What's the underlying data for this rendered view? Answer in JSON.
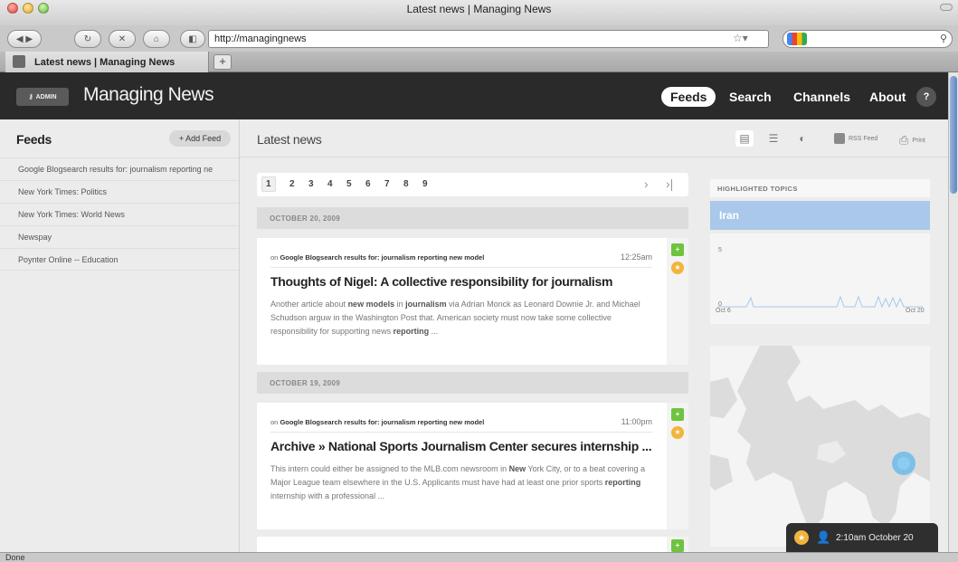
{
  "window": {
    "title": "Latest news | Managing News",
    "url": "http://managingnews",
    "tab_title": "Latest news | Managing News",
    "status": "Done"
  },
  "site": {
    "admin_label": "ADMIN",
    "name": "Managing News",
    "nav": [
      "Feeds",
      "Search",
      "Channels",
      "About"
    ],
    "help": "?"
  },
  "sidebar": {
    "title": "Feeds",
    "add_feed": "+ Add Feed",
    "feeds": [
      "Google Blogsearch results for: journalism reporting ne",
      "New York Times: Politics",
      "New York Times: World News",
      "Newspay",
      "Poynter Online -- Education"
    ]
  },
  "main": {
    "title": "Latest news",
    "rss_label": "RSS Feed",
    "print_label": "Print",
    "pages": [
      "1",
      "2",
      "3",
      "4",
      "5",
      "6",
      "7",
      "8",
      "9"
    ],
    "next": "›",
    "last": "›|",
    "groups": [
      {
        "date": "OCTOBER 20, 2009",
        "item": {
          "meta_prefix": "on ",
          "source": "Google Blogsearch results for: journalism reporting new model",
          "time": "12:25am",
          "title": "Thoughts of Nigel: A collective responsibility for journalism",
          "body": "Another article about <b>new models</b> in <b>journalism</b> via Adrian Monck as Leonard Downie Jr. and Michael Schudson arguw in the Washington Post that. American society must now take some collective responsibility for supporting news <b>reporting</b> ..."
        }
      },
      {
        "date": "OCTOBER 19, 2009",
        "item": {
          "meta_prefix": "on ",
          "source": "Google Blogsearch results for: journalism reporting new model",
          "time": "11:00pm",
          "title": "Archive » National Sports Journalism Center secures internship ...",
          "body": "This intern could either be assigned to the MLB.com newsroom in <b>New</b> York City, or to a beat covering a Major League team elsewhere in the U.S. Applicants must have had at least one prior sports <b>reporting</b> internship with a professional ..."
        }
      }
    ]
  },
  "topics": {
    "heading": "HIGHLIGHTED TOPICS",
    "highlighted": "Iran",
    "spark": {
      "y_max": "5",
      "y_min": "0",
      "x_start": "Oct 6",
      "x_end": "Oct 20"
    }
  },
  "notification": {
    "text": "2:10am October 20"
  },
  "colors": {
    "header_bg": "#2a2a2a",
    "topic_highlight": "#a9c8ea",
    "add_green": "#6ec43e",
    "star_orange": "#f2b43c",
    "map_dot": "#5fb6ec"
  }
}
